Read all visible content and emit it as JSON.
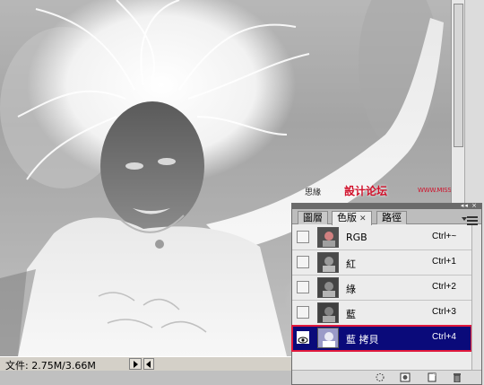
{
  "status_bar": {
    "file_info": "文件: 2.75M/3.66M"
  },
  "watermark": {
    "text_dark": "思緣",
    "text_red": "設计论坛",
    "url": "WWW.MISSYUAN.COM"
  },
  "channels_panel": {
    "tabs": [
      {
        "label": "圖層",
        "active": false
      },
      {
        "label": "色版",
        "active": true,
        "closable": true
      },
      {
        "label": "路徑",
        "active": false
      }
    ],
    "channels": [
      {
        "name": "RGB",
        "shortcut": "Ctrl+~",
        "visible": false,
        "selected": false
      },
      {
        "name": "紅",
        "shortcut": "Ctrl+1",
        "visible": false,
        "selected": false
      },
      {
        "name": "綠",
        "shortcut": "Ctrl+2",
        "visible": false,
        "selected": false
      },
      {
        "name": "藍",
        "shortcut": "Ctrl+3",
        "visible": false,
        "selected": false
      },
      {
        "name": "藍 拷貝",
        "shortcut": "Ctrl+4",
        "visible": true,
        "selected": true
      }
    ],
    "footer_buttons": [
      "load-selection-icon",
      "save-selection-icon",
      "new-channel-icon",
      "trash-icon"
    ],
    "colors": {
      "selected_row_bg": "#0a0a7a",
      "highlight_outline": "#e0183c"
    }
  }
}
